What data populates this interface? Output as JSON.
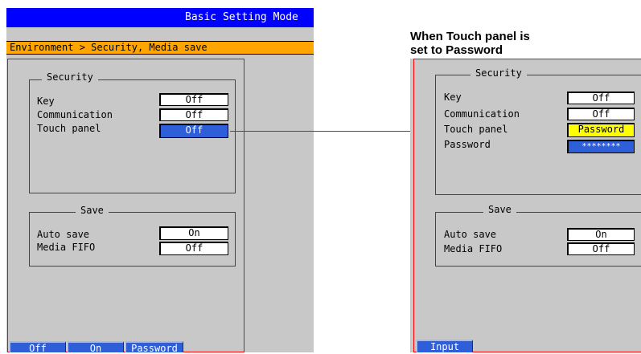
{
  "left": {
    "title": "Basic Setting Mode",
    "breadcrumb": "Environment > Security, Media save",
    "security": {
      "title": "Security",
      "rows": [
        {
          "label": "Key",
          "value": "Off"
        },
        {
          "label": "Communication",
          "value": "Off"
        },
        {
          "label": "Touch panel",
          "value": "Off"
        }
      ]
    },
    "save": {
      "title": "Save",
      "rows": [
        {
          "label": "Auto save",
          "value": "On"
        },
        {
          "label": "Media FIFO",
          "value": "Off"
        }
      ]
    },
    "softkeys": [
      "Off",
      "On",
      "Password"
    ]
  },
  "note": {
    "line1": "When Touch panel is",
    "line2": "set to Password"
  },
  "right": {
    "security": {
      "title": "Security",
      "rows": [
        {
          "label": "Key",
          "value": "Off"
        },
        {
          "label": "Communication",
          "value": "Off"
        },
        {
          "label": "Touch panel",
          "value": "Password"
        },
        {
          "label": "Password",
          "value": "********"
        }
      ]
    },
    "save": {
      "title": "Save",
      "rows": [
        {
          "label": "Auto save",
          "value": "On"
        },
        {
          "label": "Media FIFO",
          "value": "Off"
        }
      ]
    },
    "softkeys": [
      "Input"
    ]
  },
  "colors": {
    "titlebar": "#0000ff",
    "breadcrumb": "#ffa500",
    "selection": "#2f5fd8",
    "highlight": "#ffff00",
    "frame": "#ff0000"
  }
}
